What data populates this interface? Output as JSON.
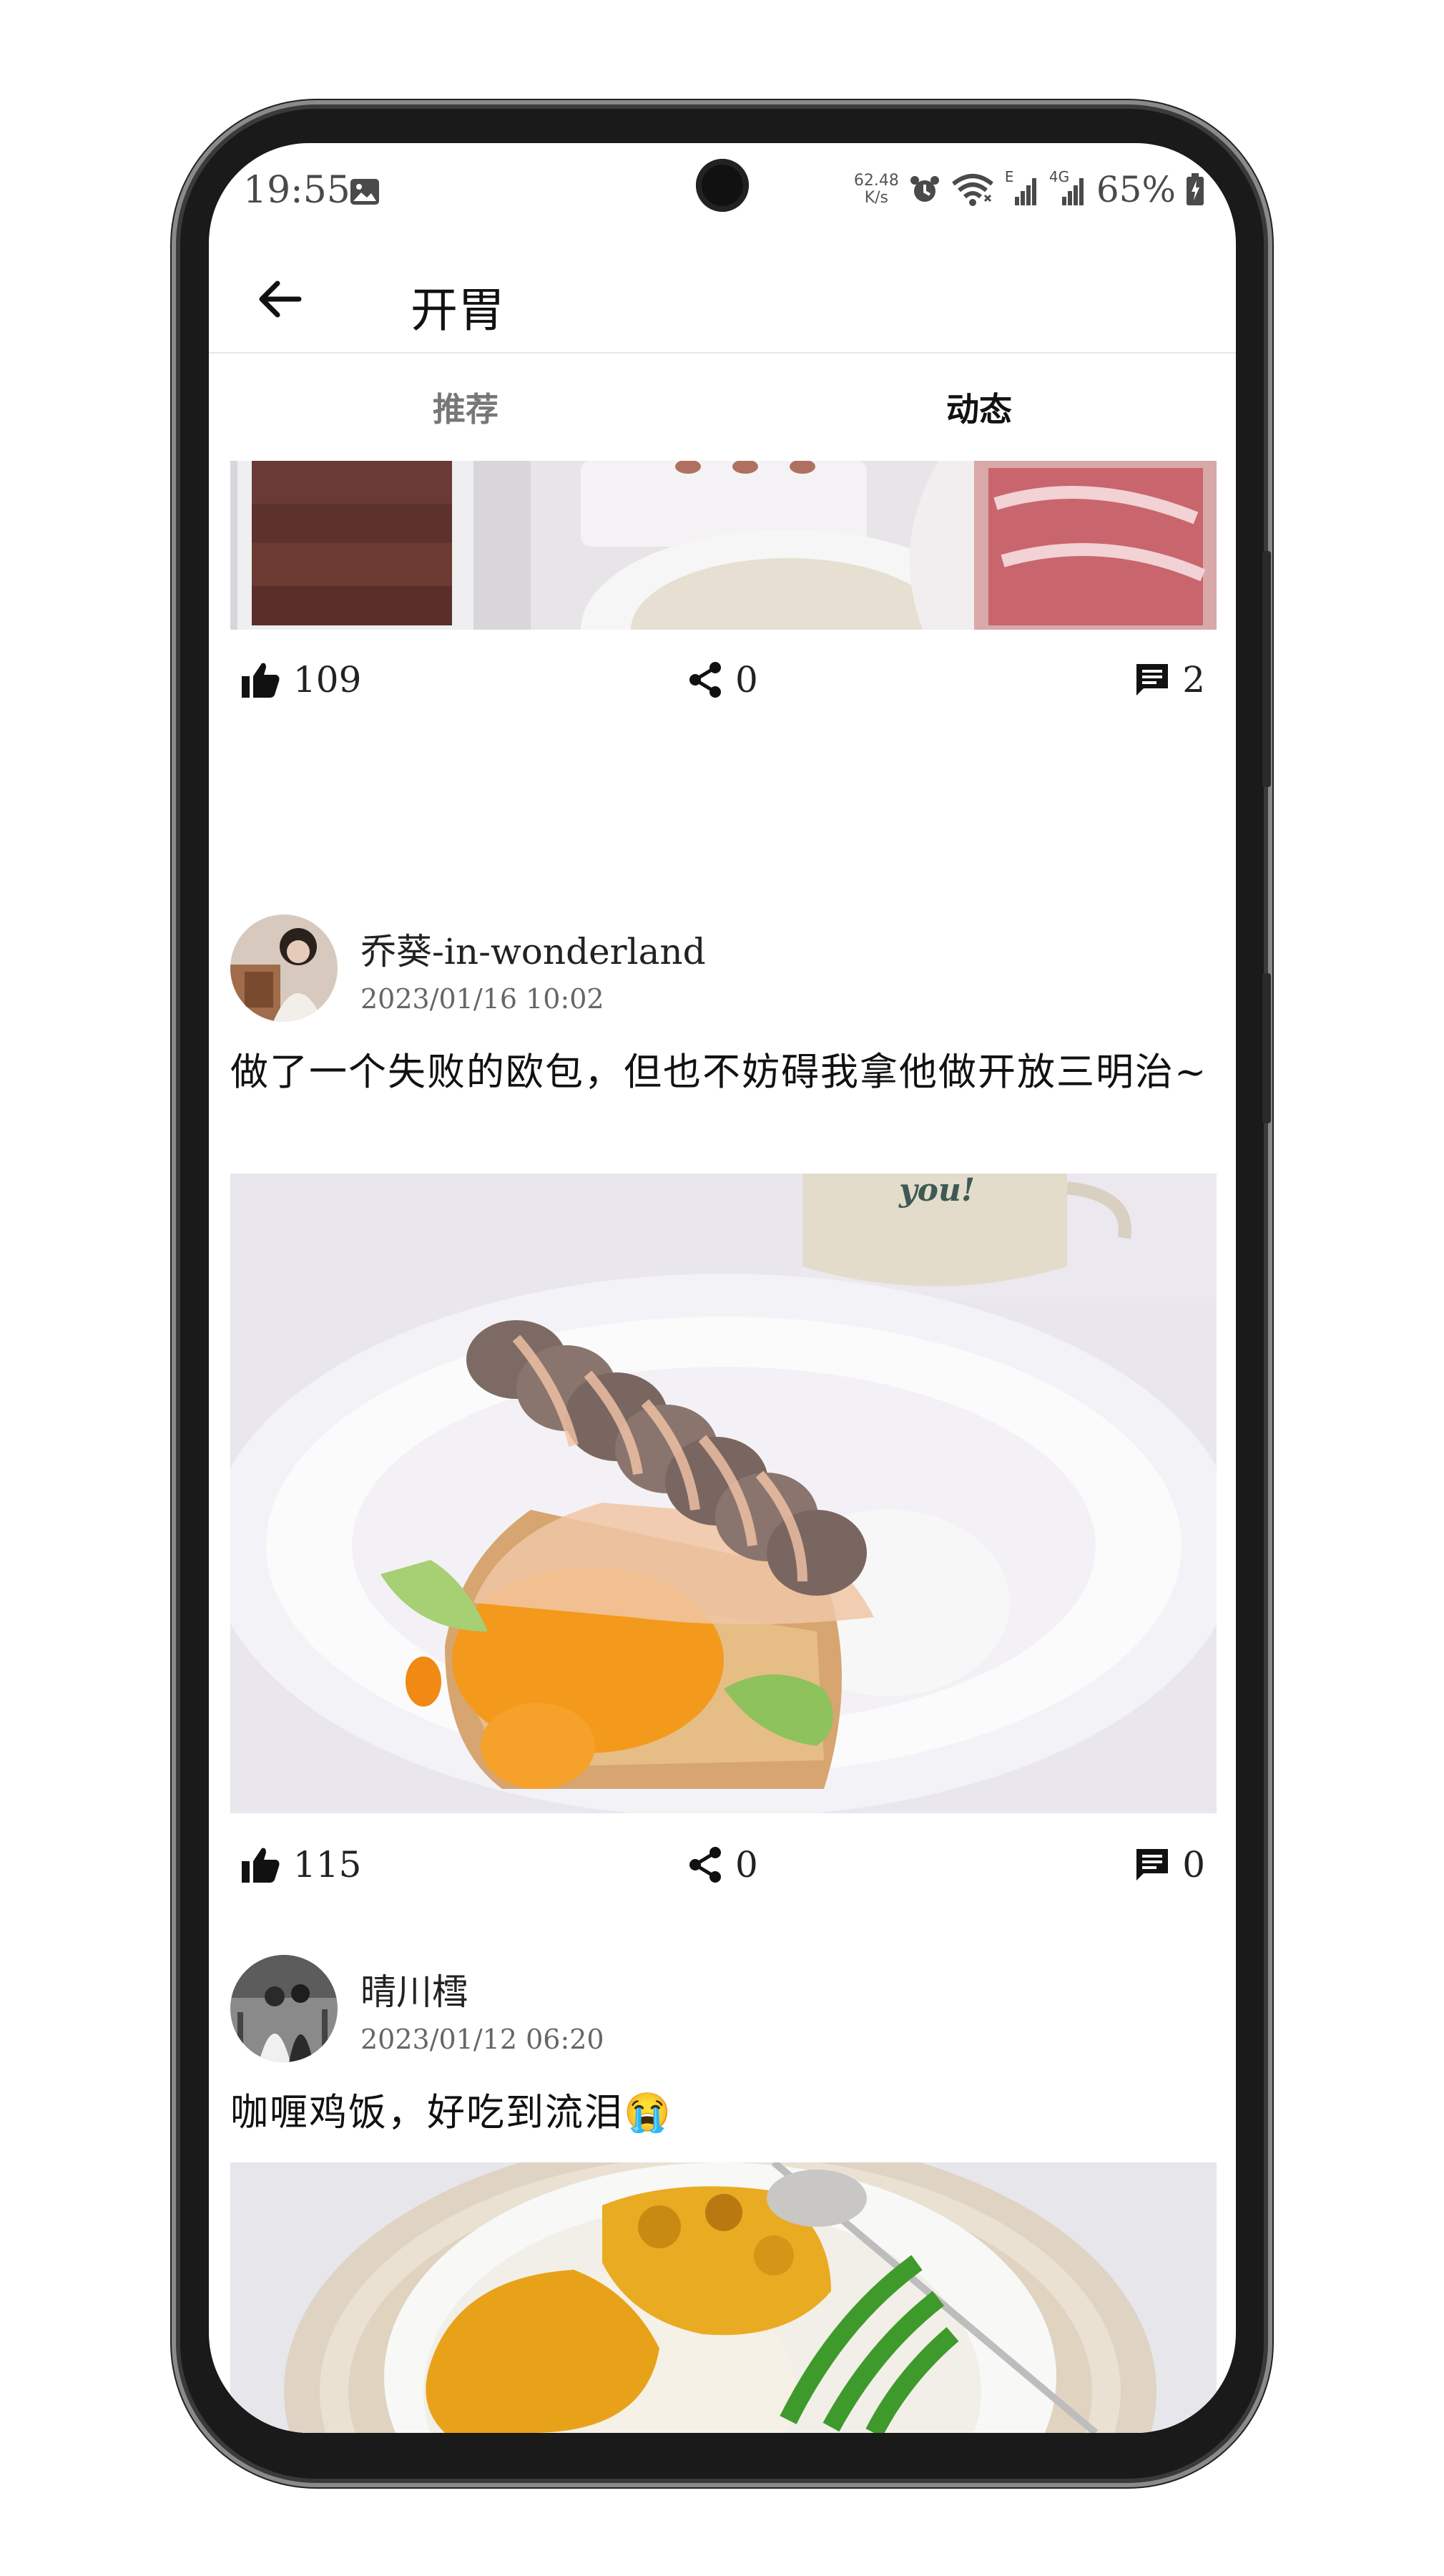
{
  "status_bar": {
    "time": "19:55",
    "speed_value": "62.48",
    "speed_unit": "K/s",
    "network_e": "E",
    "network_4g": "4G",
    "battery": "65%"
  },
  "app_bar": {
    "title": "开胃"
  },
  "tabs": [
    {
      "label": "推荐",
      "active": false
    },
    {
      "label": "动态",
      "active": true
    }
  ],
  "posts": [
    {
      "likes": "109",
      "shares": "0",
      "comments": "2"
    },
    {
      "username": "乔葵-in-wonderland",
      "time": "2023/01/16 10:02",
      "text": "做了一个失败的欧包，但也不妨碍我拿他做开放三明治~",
      "likes": "115",
      "shares": "0",
      "comments": "0"
    },
    {
      "username": "晴川樰",
      "time": "2023/01/12 06:20",
      "text": "咖喱鸡饭，好吃到流泪😭"
    }
  ],
  "colors": {
    "background": "#ffffff",
    "text_primary": "#111111",
    "text_secondary": "#666666",
    "tab_inactive": "#777777",
    "divider": "#e6e6e6"
  }
}
